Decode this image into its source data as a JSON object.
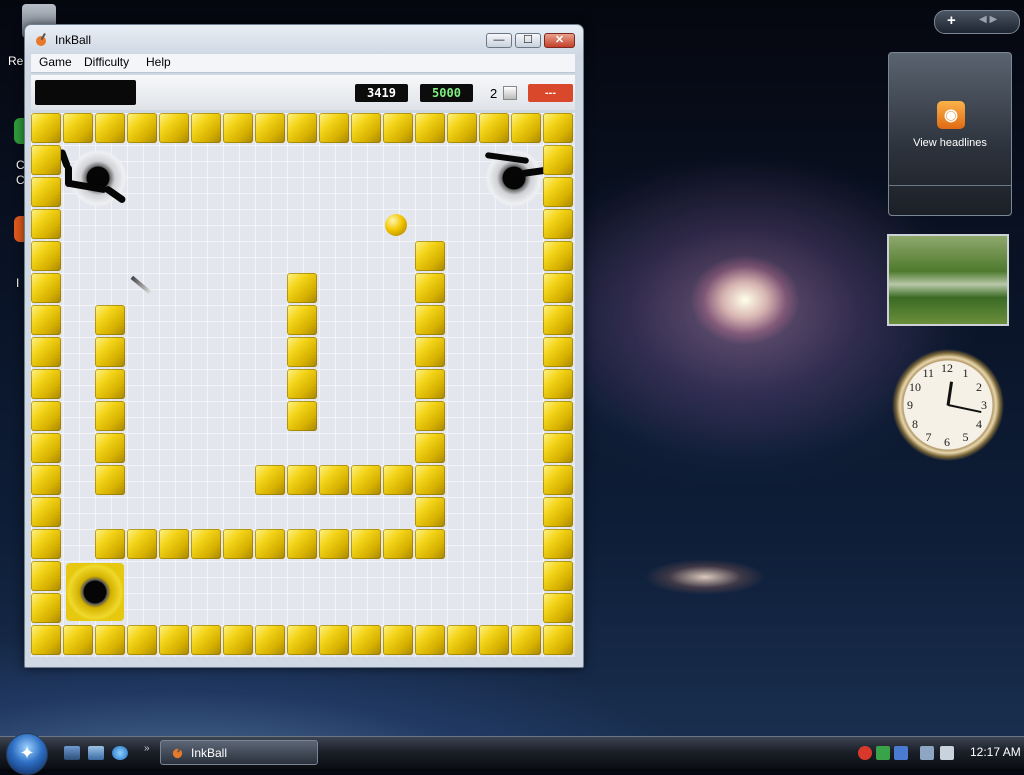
{
  "desktop": {
    "recycle_label": "Re",
    "icon_label_1": "C",
    "icon_label_2": "C",
    "icon_label_3": "I"
  },
  "window": {
    "title": "InkBall",
    "menu": [
      "Game",
      "Difficulty",
      "Help"
    ],
    "controls": {
      "minimize": "—",
      "maximize": "☐",
      "close": "✕"
    }
  },
  "toolbar": {
    "current_score": "3419",
    "best_score": "5000",
    "balls_remaining": "2",
    "status": "---"
  },
  "gadgets": {
    "feed_text": "View headlines",
    "clock": {
      "numbers": [
        "12",
        "1",
        "2",
        "3",
        "4",
        "5",
        "6",
        "7",
        "8",
        "9",
        "10",
        "11"
      ],
      "time": "12:17"
    }
  },
  "taskbar": {
    "task_label": "InkBall",
    "time": "12:17 AM",
    "start_icon": "windows-logo-icon"
  },
  "colors": {
    "tile": "#f3d418",
    "score_best": "#7ef07e",
    "status": "#d9482a"
  }
}
